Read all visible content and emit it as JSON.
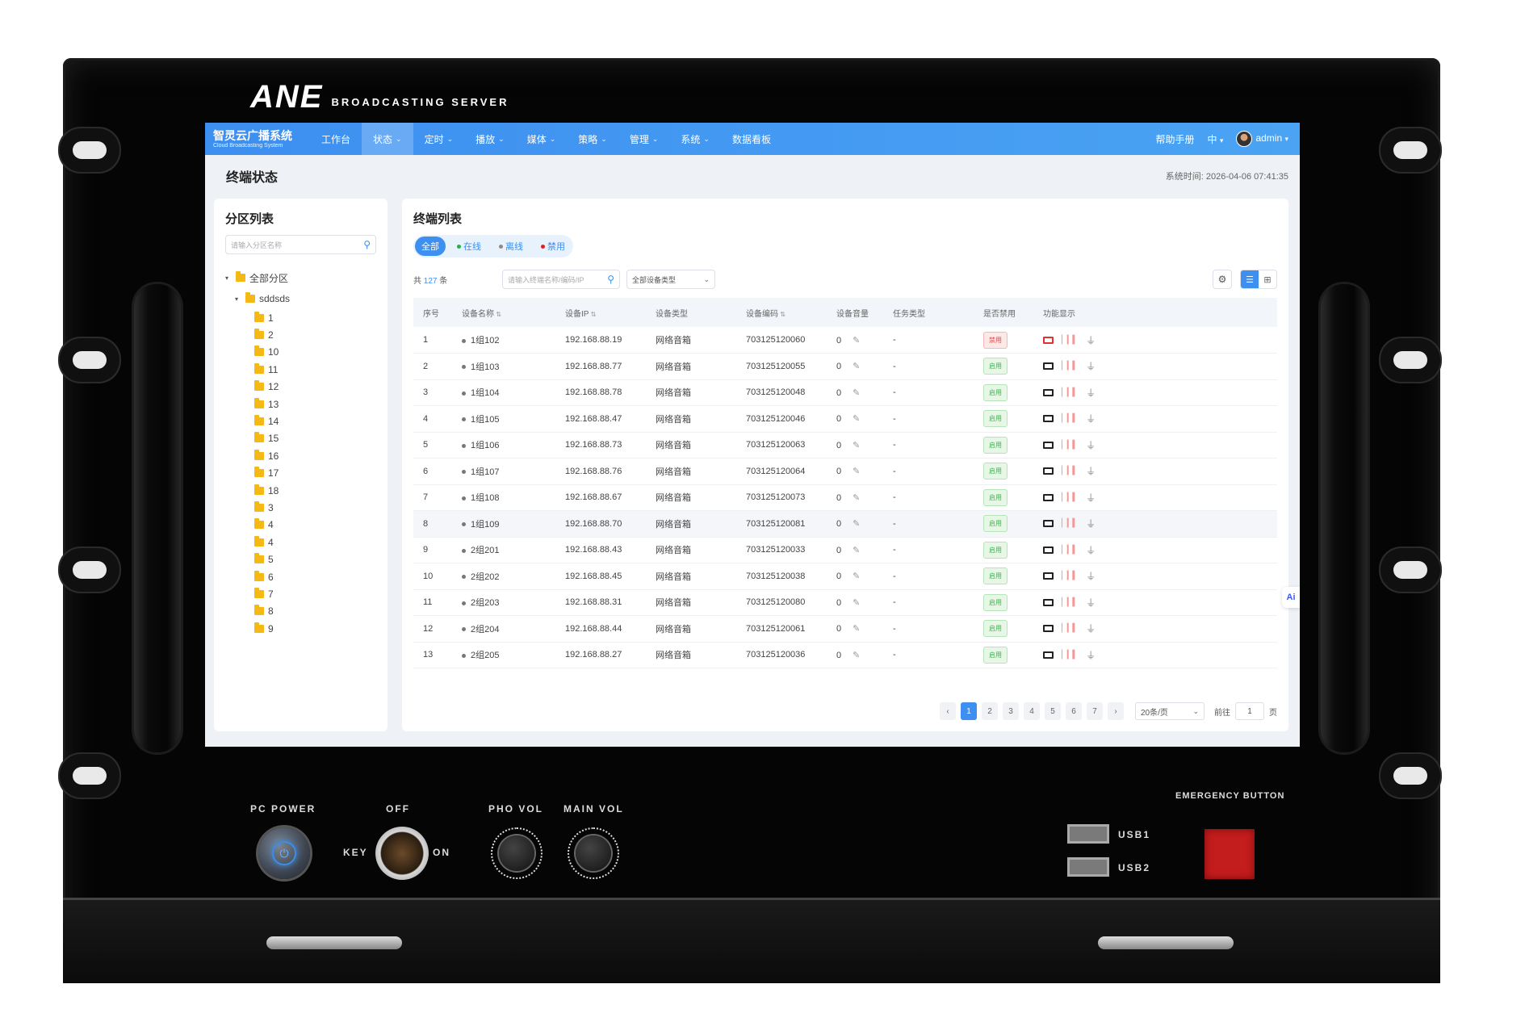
{
  "hardware": {
    "brand": "ANE",
    "brand_sub": "BROADCASTING SERVER",
    "pc_power": "PC POWER",
    "off": "OFF",
    "key": "KEY",
    "on": "ON",
    "pho_vol": "PHO VOL",
    "main_vol": "MAIN VOL",
    "usb1": "USB1",
    "usb2": "USB2",
    "emergency": "EMERGENCY BUTTON"
  },
  "app": {
    "title": "智灵云广播系统",
    "subtitle": "Cloud Broadcasting System"
  },
  "nav": {
    "items": [
      {
        "label": "工作台",
        "dropdown": false,
        "active": false
      },
      {
        "label": "状态",
        "dropdown": true,
        "active": true
      },
      {
        "label": "定时",
        "dropdown": true,
        "active": false
      },
      {
        "label": "播放",
        "dropdown": true,
        "active": false
      },
      {
        "label": "媒体",
        "dropdown": true,
        "active": false
      },
      {
        "label": "策略",
        "dropdown": true,
        "active": false
      },
      {
        "label": "管理",
        "dropdown": true,
        "active": false
      },
      {
        "label": "系统",
        "dropdown": true,
        "active": false
      },
      {
        "label": "数据看板",
        "dropdown": false,
        "active": false
      }
    ],
    "help": "帮助手册",
    "lang": "中",
    "user": "admin"
  },
  "page": {
    "title": "终端状态",
    "sys_time": "系统时间: 2026-04-06 07:41:35"
  },
  "zones": {
    "title": "分区列表",
    "search_placeholder": "请输入分区名称",
    "root": "全部分区",
    "group": "sddsds",
    "children": [
      "1",
      "2",
      "10",
      "11",
      "12",
      "13",
      "14",
      "15",
      "16",
      "17",
      "18",
      "3",
      "4",
      "4",
      "5",
      "6",
      "7",
      "8",
      "9"
    ]
  },
  "terminals": {
    "title": "终端列表",
    "filters": [
      {
        "label": "全部",
        "active": true,
        "dot": ""
      },
      {
        "label": "在线",
        "active": false,
        "dot": "#22b14c"
      },
      {
        "label": "离线",
        "active": false,
        "dot": "#8a8a8a"
      },
      {
        "label": "禁用",
        "active": false,
        "dot": "#e02020"
      }
    ],
    "count_prefix": "共",
    "count": "127",
    "count_suffix": "条",
    "search_placeholder": "请输入终端名称/编码/IP",
    "type_select": "全部设备类型",
    "columns": [
      "序号",
      "设备名称",
      "设备IP",
      "设备类型",
      "设备编码",
      "设备音量",
      "任务类型",
      "是否禁用",
      "功能显示"
    ],
    "rows": [
      {
        "no": "1",
        "name": "1组102",
        "ip": "192.168.88.19",
        "type": "网络音箱",
        "code": "703125120060",
        "vol": "0",
        "task": "-",
        "status": "禁用",
        "disabled": true
      },
      {
        "no": "2",
        "name": "1组103",
        "ip": "192.168.88.77",
        "type": "网络音箱",
        "code": "703125120055",
        "vol": "0",
        "task": "-",
        "status": "启用",
        "disabled": false
      },
      {
        "no": "3",
        "name": "1组104",
        "ip": "192.168.88.78",
        "type": "网络音箱",
        "code": "703125120048",
        "vol": "0",
        "task": "-",
        "status": "启用",
        "disabled": false
      },
      {
        "no": "4",
        "name": "1组105",
        "ip": "192.168.88.47",
        "type": "网络音箱",
        "code": "703125120046",
        "vol": "0",
        "task": "-",
        "status": "启用",
        "disabled": false
      },
      {
        "no": "5",
        "name": "1组106",
        "ip": "192.168.88.73",
        "type": "网络音箱",
        "code": "703125120063",
        "vol": "0",
        "task": "-",
        "status": "启用",
        "disabled": false
      },
      {
        "no": "6",
        "name": "1组107",
        "ip": "192.168.88.76",
        "type": "网络音箱",
        "code": "703125120064",
        "vol": "0",
        "task": "-",
        "status": "启用",
        "disabled": false
      },
      {
        "no": "7",
        "name": "1组108",
        "ip": "192.168.88.67",
        "type": "网络音箱",
        "code": "703125120073",
        "vol": "0",
        "task": "-",
        "status": "启用",
        "disabled": false
      },
      {
        "no": "8",
        "name": "1组109",
        "ip": "192.168.88.70",
        "type": "网络音箱",
        "code": "703125120081",
        "vol": "0",
        "task": "-",
        "status": "启用",
        "disabled": false,
        "highlight": true
      },
      {
        "no": "9",
        "name": "2组201",
        "ip": "192.168.88.43",
        "type": "网络音箱",
        "code": "703125120033",
        "vol": "0",
        "task": "-",
        "status": "启用",
        "disabled": false
      },
      {
        "no": "10",
        "name": "2组202",
        "ip": "192.168.88.45",
        "type": "网络音箱",
        "code": "703125120038",
        "vol": "0",
        "task": "-",
        "status": "启用",
        "disabled": false
      },
      {
        "no": "11",
        "name": "2组203",
        "ip": "192.168.88.31",
        "type": "网络音箱",
        "code": "703125120080",
        "vol": "0",
        "task": "-",
        "status": "启用",
        "disabled": false
      },
      {
        "no": "12",
        "name": "2组204",
        "ip": "192.168.88.44",
        "type": "网络音箱",
        "code": "703125120061",
        "vol": "0",
        "task": "-",
        "status": "启用",
        "disabled": false
      },
      {
        "no": "13",
        "name": "2组205",
        "ip": "192.168.88.27",
        "type": "网络音箱",
        "code": "703125120036",
        "vol": "0",
        "task": "-",
        "status": "启用",
        "disabled": false
      }
    ]
  },
  "pagination": {
    "prev": "‹",
    "next": "›",
    "pages": [
      "1",
      "2",
      "3",
      "4",
      "5",
      "6",
      "7"
    ],
    "current": "1",
    "page_size": "20条/页",
    "goto_label": "前往",
    "goto_value": "1",
    "goto_suffix": "页"
  },
  "ai_button": "Ai",
  "colors": {
    "primary": "#3d8ff0",
    "enabled_tag": "#3fb34f",
    "disabled_tag": "#e54b4b",
    "emergency": "#c31d1d"
  }
}
